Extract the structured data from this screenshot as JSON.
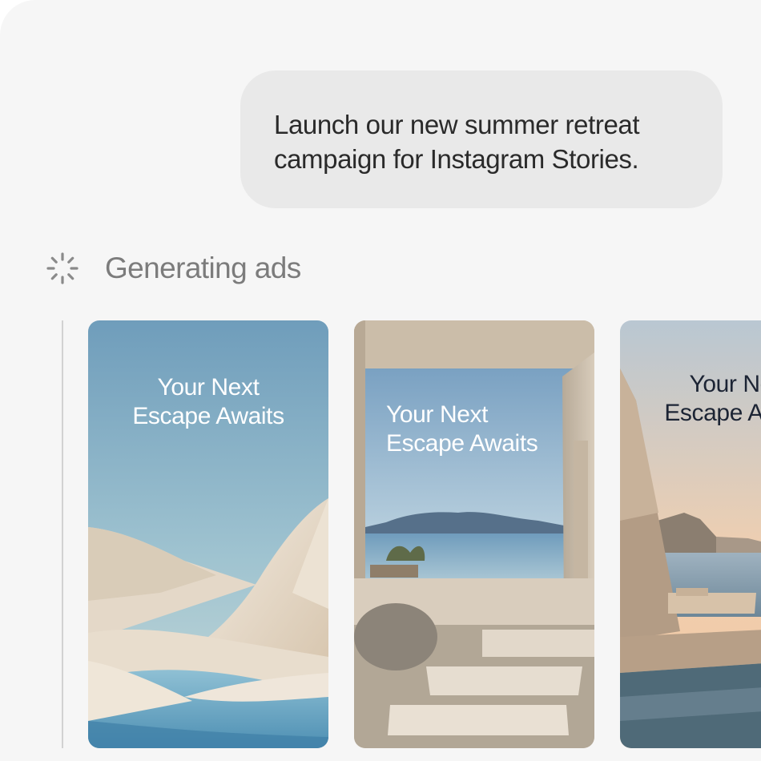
{
  "chat": {
    "user_message": "Launch our new summer retreat\ncampaign for Instagram Stories."
  },
  "status": {
    "label": "Generating ads",
    "icon": "loading-spinner-icon"
  },
  "ads": [
    {
      "headline": "Your Next\nEscape Awaits",
      "scene": "desert-dunes-water"
    },
    {
      "headline": "Your Next\nEscape Awaits",
      "scene": "stone-terrace-sea-view"
    },
    {
      "headline": "Your Next\nEscape Awaits",
      "scene": "sunset-infinity-pool"
    }
  ],
  "colors": {
    "panel_bg": "#f6f6f6",
    "bubble_bg": "#e9e9e9",
    "status_text": "#7c7c7c"
  }
}
